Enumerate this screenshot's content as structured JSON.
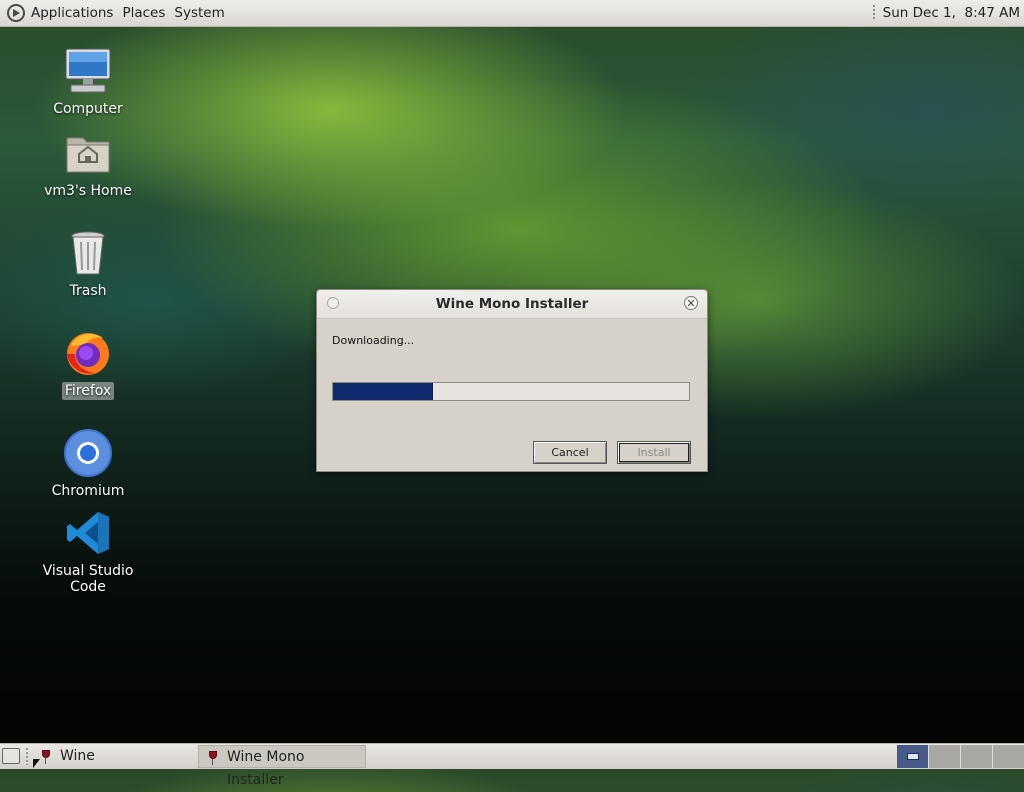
{
  "top_panel": {
    "menus": [
      "Applications",
      "Places",
      "System"
    ],
    "clock": "Sun Dec 1,  8:47 AM"
  },
  "desktop_icons": [
    {
      "label": "Computer",
      "icon": "computer-icon"
    },
    {
      "label": "vm3's Home",
      "icon": "home-folder-icon"
    },
    {
      "label": "Trash",
      "icon": "trash-icon"
    },
    {
      "label": "Firefox",
      "icon": "firefox-icon",
      "selected": true
    },
    {
      "label": "Chromium",
      "icon": "chromium-icon"
    },
    {
      "label": "Visual Studio Code",
      "icon": "vscode-icon"
    }
  ],
  "dialog": {
    "title": "Wine Mono Installer",
    "status": "Downloading...",
    "progress_fraction": 0.28,
    "cancel_label": "Cancel",
    "install_label": "Install"
  },
  "taskbar": {
    "items": [
      "Wine",
      "Wine Mono Installer"
    ]
  },
  "colors": {
    "progress_fill": "#102a6e",
    "active_workspace": "#485b8a"
  }
}
